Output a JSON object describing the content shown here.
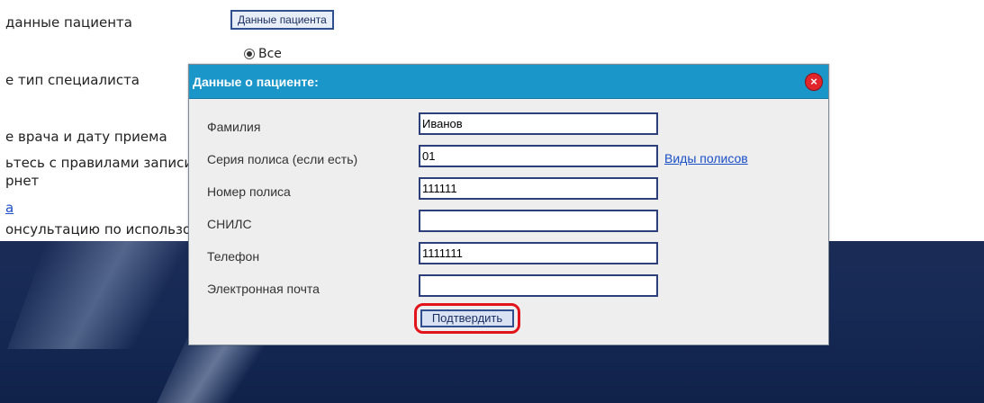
{
  "background": {
    "line1": "данные пациента",
    "line2": "е тип специалиста",
    "line3": "е врача и дату приема",
    "line4": "ьтесь с правилами записи",
    "line5": "рнет",
    "line6_link": "а",
    "line7": "онсультацию по использо",
    "top_button": "Данные пациента",
    "radio_label": "Все"
  },
  "dialog": {
    "title": "Данные о пациенте:",
    "close_symbol": "×",
    "fields": [
      {
        "label": "Фамилия",
        "value": ""
      },
      {
        "label": "Серия полиса (если есть)",
        "value": "01"
      },
      {
        "label": "Номер полиса",
        "value": "111111"
      },
      {
        "label": "СНИЛС",
        "value": ""
      },
      {
        "label": "Телефон",
        "value": "1111111"
      },
      {
        "label": "Электронная почта",
        "value": ""
      }
    ],
    "surname_value": "Иванов",
    "policy_types_link": "Виды полисов",
    "confirm_button": "Подтвердить"
  },
  "colors": {
    "header": "#1a96c9",
    "close": "#e0262b",
    "highlight": "#e0141a",
    "band": "#162a55"
  }
}
